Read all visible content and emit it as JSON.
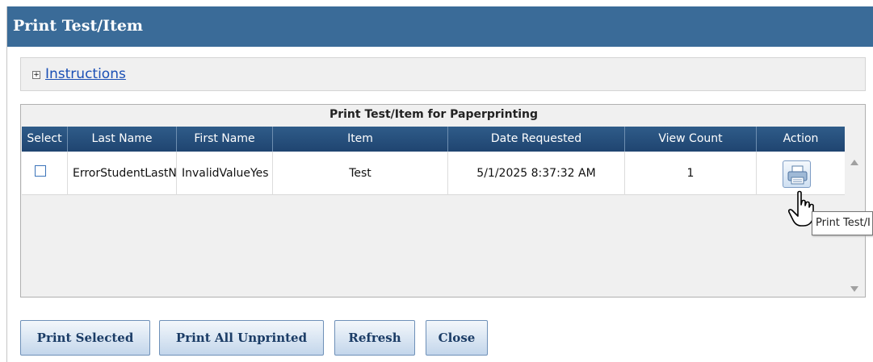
{
  "dialog": {
    "title": "Print Test/Item"
  },
  "instructions": {
    "expand_glyph": "+",
    "link_label": "Instructions"
  },
  "grid": {
    "caption": "Print Test/Item for Paperprinting",
    "columns": [
      "Select",
      "Last Name",
      "First Name",
      "Item",
      "Date Requested",
      "View Count",
      "Action"
    ],
    "rows": [
      {
        "selected": false,
        "last_name": "ErrorStudentLastN",
        "first_name": "InvalidValueYes",
        "item": "Test",
        "date_requested": "5/1/2025 8:37:32 AM",
        "view_count": "1",
        "action_icon": "printer-icon"
      }
    ]
  },
  "tooltip": {
    "text": "Print Test/I"
  },
  "buttons": {
    "print_selected": "Print Selected",
    "print_all_unprinted": "Print All Unprinted",
    "refresh": "Refresh",
    "close": "Close"
  },
  "colors": {
    "titlebar": "#3a6b98",
    "header": "#1f4470",
    "link": "#1a4fb5",
    "button_text": "#1b3c66"
  }
}
